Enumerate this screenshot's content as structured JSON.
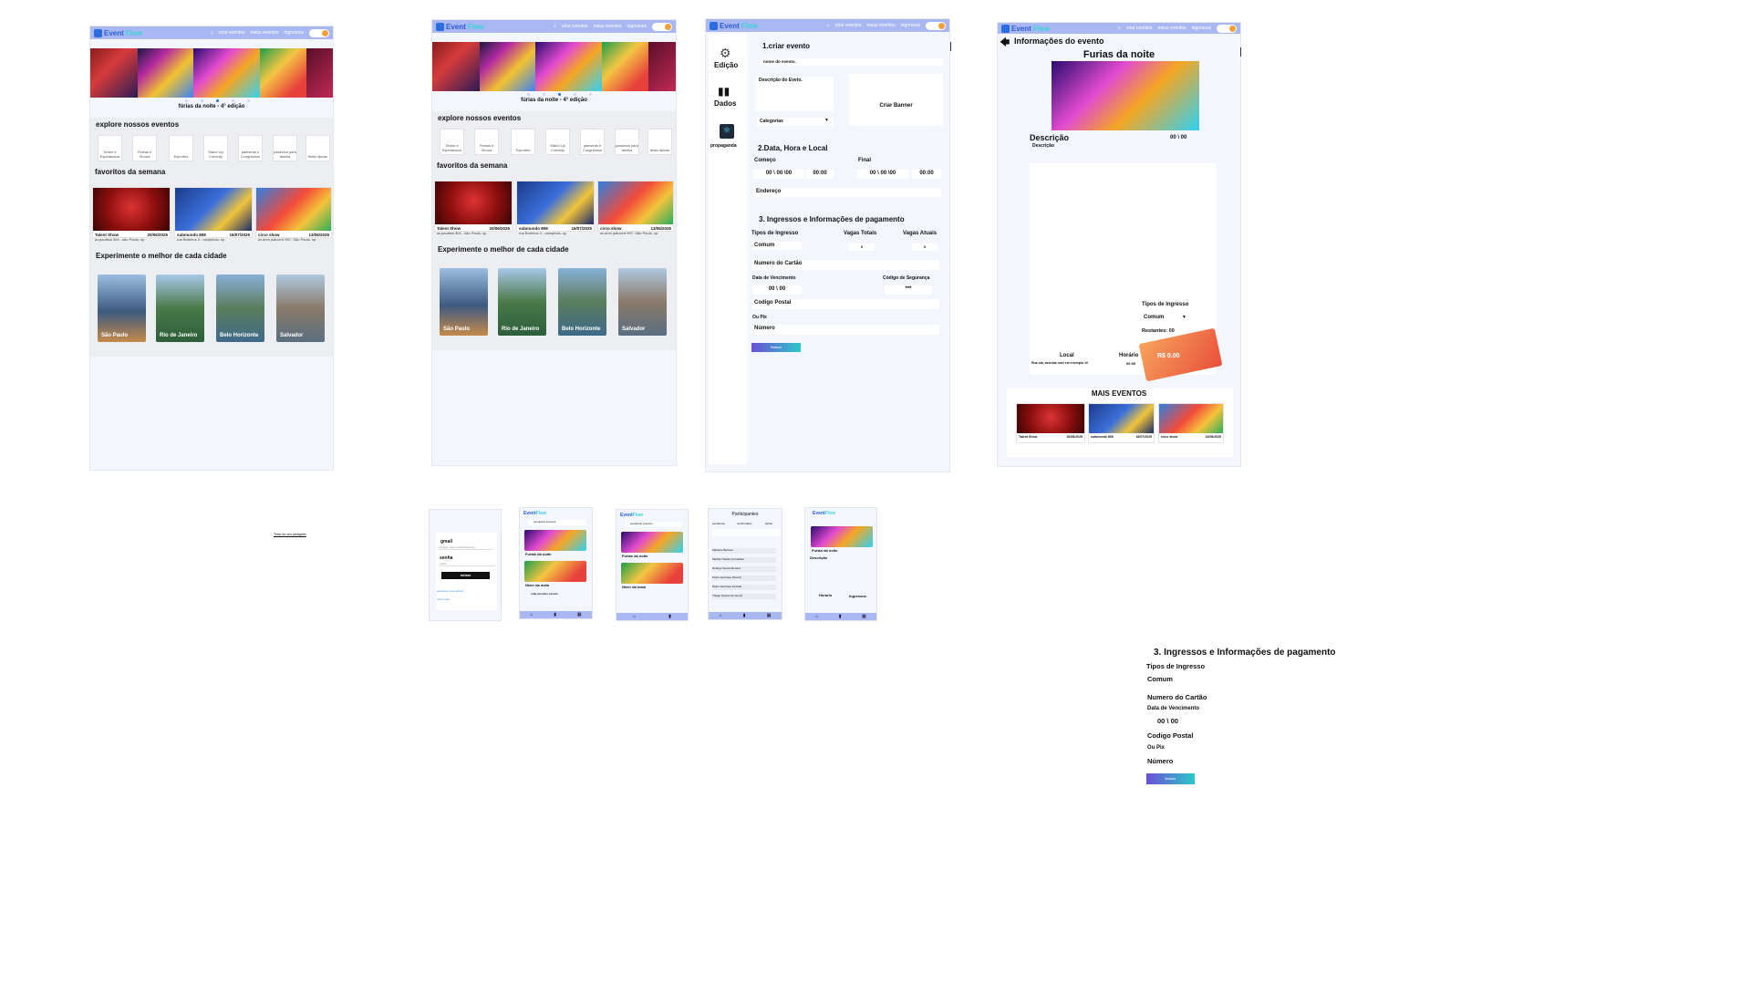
{
  "brand": {
    "name_a": "Event",
    "name_b": "Flow",
    "accent": "#2a5ad8",
    "accent2": "#3ad3d9",
    "bar": "#a9b8f0"
  },
  "nav": {
    "create": "criar eventos",
    "mine": "meus eventos",
    "tickets": "ingressos"
  },
  "home": {
    "banner_caption": "fúrias da noite - 4° edição",
    "explore_title": "explore nossos eventos",
    "categories": [
      "Teatro e Espetáculos",
      "Festas e Shows",
      "Esportes",
      "Stand Up Comedy",
      "palestras e Congressos",
      "passeios para família",
      "festa típicas"
    ],
    "favorites_title": "favoritos da semana",
    "cards": [
      {
        "title": "Talent Show",
        "date": "20/06/2025",
        "addr": "av.paulista 304 - são Paulo, sp"
      },
      {
        "title": "submundo 808",
        "date": "16/07/2025",
        "addr": "rua Boteiros 4 - campinas, sp"
      },
      {
        "title": "circo show",
        "date": "13/06/2025",
        "addr": "av.dom joãovert 997- São Paulo, sp"
      }
    ],
    "cities_title": "Experimente o melhor de cada cidade",
    "cities": [
      "São Paulo",
      "Rio de Janeiro",
      "Belo Horizonte",
      "Salvador"
    ]
  },
  "create": {
    "side": [
      "Edição",
      "Dados",
      "propaganda"
    ],
    "s1": "1.criar evento",
    "name_ph": "nome do evento.",
    "desc": "Descrição do Eveto.",
    "banner": "Criar Banner",
    "cat": "Categorias",
    "s2": "2.Data, Hora e Local",
    "start": "Começo",
    "end": "Final",
    "date": "00 \\ 00 \\00",
    "time": "00:00",
    "addr": "Endereço",
    "s3": "3. Ingressos e Informações de pagamento",
    "types": "Tipos de Ingresso",
    "total": "Vagas Totais",
    "current": "Vagas Atuais",
    "common": "Comum",
    "num_a": "0",
    "num_b": "0",
    "card": "Numero do Cartão",
    "due": "Data de Vencimento",
    "sec": "Código de Segurança",
    "due_v": "00 \\ 00",
    "sec_v": "***",
    "zip": "Codigo Postal",
    "pix": "Ou Pix",
    "number": "Número",
    "finish": "finalizar"
  },
  "info": {
    "back": "Informações do evento",
    "title": "Furias da noite",
    "desc_h": "Descrição",
    "desc": "Descrição",
    "date": "00 \\ 00",
    "types": "Tipos de Ingresso",
    "common": "Comum",
    "rem": "Restantes: 00",
    "local": "Local",
    "addr": "Rua ola, avenida noel em exemplo 10",
    "hour": "Horário",
    "hour_v": "00:00",
    "price": "R$ 0.00",
    "more": "MAIS EVENTOS"
  },
  "mobile": {
    "login": {
      "email": "gmail",
      "email_ph": "exemplo_gmail_teste@email.com",
      "pw": "senha",
      "pw_ph": "senha",
      "enter": "entrar",
      "forgot": "esqueceu sua senha?",
      "create": "criar conta"
    },
    "forgot_link": "Texto do seu parágrafo",
    "search": "pesquisar eventos",
    "e1": "Furias da noite",
    "e2": "Niver da malu",
    "create_next": "criar proximo evento",
    "part_title": "Participantes",
    "part_cols": [
      "pendentes",
      "confirmados",
      "ações"
    ],
    "people": [
      "Matheus Barroso",
      "Martha Thaíde Guimarães",
      "Rodrigo Souza Moreira",
      "Pedro Henrique Pereira",
      "Pedro Henrique Furtado",
      "Thiago Soares de Souza"
    ],
    "detail_title": "Furias da noite",
    "detail_desc": "Descrição",
    "detail_hour": "Horario",
    "detail_tickets": "Ingressos"
  }
}
